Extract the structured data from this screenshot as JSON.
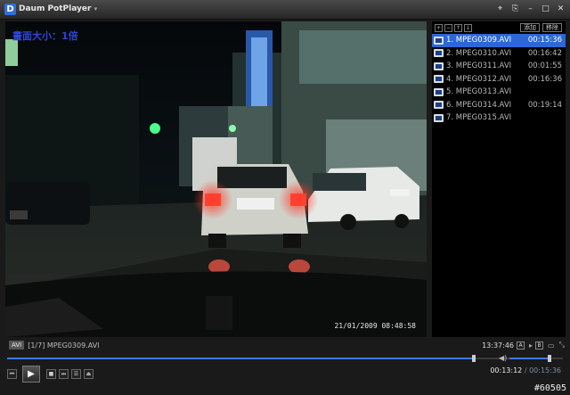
{
  "app": {
    "title": "Daum PotPlayer",
    "logo_letter": "D"
  },
  "window_controls": [
    "⌖",
    "⎘",
    "–",
    "□",
    "✕"
  ],
  "video": {
    "osd_text": "畫面大小：1倍",
    "timestamp": "21/01/2009 08:48:58"
  },
  "playlist": {
    "toolbar_buttons": [
      "+",
      "−",
      "↑",
      "↓"
    ],
    "toolbar_tags": [
      "添加",
      "移除"
    ],
    "items": [
      {
        "name": "1. MPEG0309.AVI",
        "duration": "00:15:36",
        "active": true
      },
      {
        "name": "2. MPEG0310.AVI",
        "duration": "00:16:42",
        "active": false
      },
      {
        "name": "3. MPEG0311.AVI",
        "duration": "00:01:55",
        "active": false
      },
      {
        "name": "4. MPEG0312.AVI",
        "duration": "00:16:36",
        "active": false
      },
      {
        "name": "5. MPEG0313.AVI",
        "duration": "",
        "active": false
      },
      {
        "name": "6. MPEG0314.AVI",
        "duration": "00:19:14",
        "active": false
      },
      {
        "name": "7. MPEG0315.AVI",
        "duration": "",
        "active": false
      }
    ]
  },
  "status": {
    "format": "AVI",
    "now_playing": "[1/7] MPEG0309.AVI",
    "clock": "13:37:46",
    "ab_a": "A",
    "ab_b": "B"
  },
  "playback": {
    "progress": 0.84,
    "volume": 0.8,
    "current_time": "00:13:12",
    "separator": "/",
    "total_time": "00:15:36"
  },
  "watermark": "#60505",
  "colors": {
    "accent": "#2d66d8",
    "seek": "#3d78ff"
  }
}
